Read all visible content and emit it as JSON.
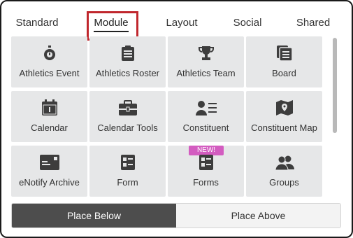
{
  "tabs": [
    {
      "label": "Standard",
      "active": false
    },
    {
      "label": "Module",
      "active": true
    },
    {
      "label": "Layout",
      "active": false
    },
    {
      "label": "Social",
      "active": false
    },
    {
      "label": "Shared",
      "active": false
    }
  ],
  "tiles": [
    {
      "label": "Athletics Event",
      "icon": "stopwatch-icon"
    },
    {
      "label": "Athletics Roster",
      "icon": "clipboard-icon"
    },
    {
      "label": "Athletics Team",
      "icon": "trophy-icon"
    },
    {
      "label": "Board",
      "icon": "board-icon"
    },
    {
      "label": "Calendar",
      "icon": "calendar-icon"
    },
    {
      "label": "Calendar Tools",
      "icon": "toolbox-icon"
    },
    {
      "label": "Constituent",
      "icon": "person-list-icon"
    },
    {
      "label": "Constituent Map",
      "icon": "map-pin-icon"
    },
    {
      "label": "eNotify Archive",
      "icon": "enotify-icon"
    },
    {
      "label": "Form",
      "icon": "form-icon"
    },
    {
      "label": "Forms",
      "icon": "forms-icon",
      "badge": "NEW!"
    },
    {
      "label": "Groups",
      "icon": "groups-icon"
    }
  ],
  "buttons": {
    "place_below": "Place Below",
    "place_above": "Place Above"
  },
  "colors": {
    "icon": "#3d3d3d",
    "tile_bg": "#e6e7e8",
    "highlight": "#c0272d",
    "badge": "#d35cc0",
    "primary_btn": "#4d4d4d"
  }
}
